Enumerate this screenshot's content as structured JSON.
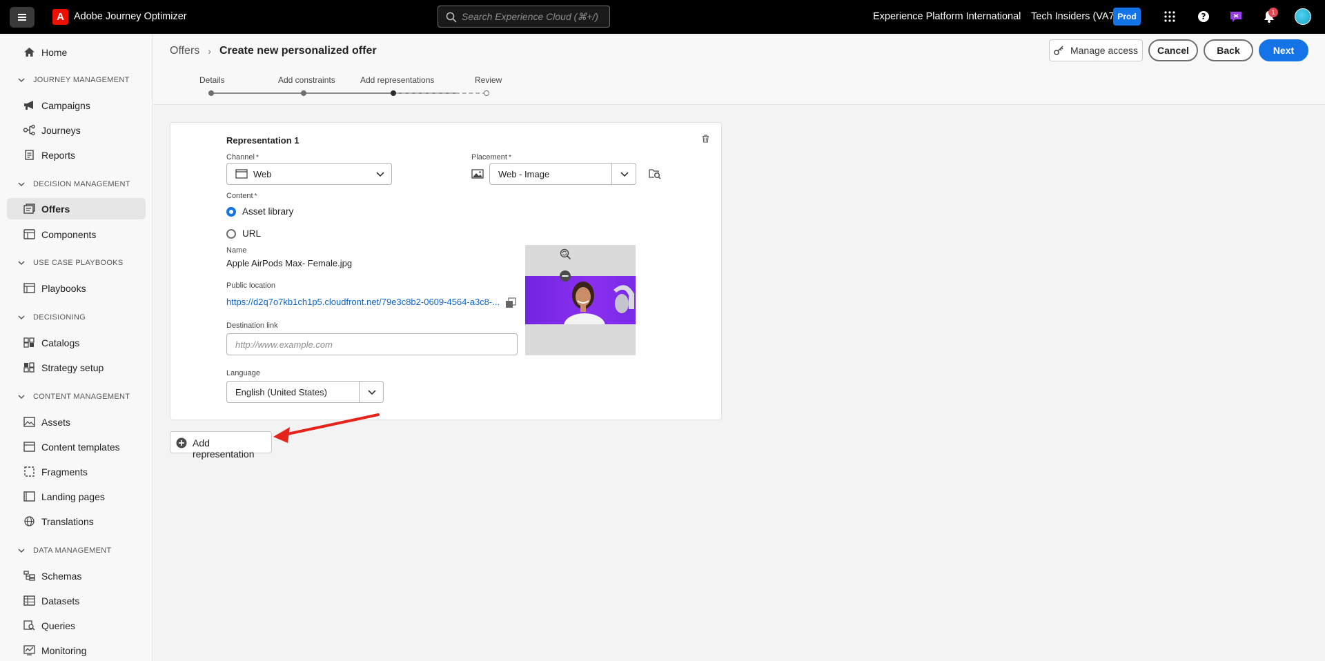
{
  "topbar": {
    "app_title": "Adobe Journey Optimizer",
    "search_placeholder": "Search Experience Cloud (⌘+/)",
    "org_name": "Experience Platform International",
    "sandbox_name": "Tech Insiders (VA7)",
    "env_badge": "Prod",
    "notification_count": "1"
  },
  "sidebar": {
    "home": "Home",
    "sections": [
      {
        "title": "JOURNEY MANAGEMENT",
        "items": [
          "Campaigns",
          "Journeys",
          "Reports"
        ]
      },
      {
        "title": "DECISION MANAGEMENT",
        "items": [
          "Offers",
          "Components"
        ]
      },
      {
        "title": "USE CASE PLAYBOOKS",
        "items": [
          "Playbooks"
        ]
      },
      {
        "title": "DECISIONING",
        "items": [
          "Catalogs",
          "Strategy setup"
        ]
      },
      {
        "title": "CONTENT MANAGEMENT",
        "items": [
          "Assets",
          "Content templates",
          "Fragments",
          "Landing pages",
          "Translations"
        ]
      },
      {
        "title": "DATA MANAGEMENT",
        "items": [
          "Schemas",
          "Datasets",
          "Queries",
          "Monitoring"
        ]
      }
    ],
    "active_item": "Offers"
  },
  "header": {
    "breadcrumb_parent": "Offers",
    "breadcrumb_current": "Create new personalized offer",
    "manage_access": "Manage access",
    "cancel": "Cancel",
    "back": "Back",
    "next": "Next"
  },
  "stepper": {
    "steps": [
      "Details",
      "Add constraints",
      "Add representations",
      "Review"
    ],
    "current_step": "Add representations"
  },
  "representation": {
    "title": "Representation 1",
    "channel_label": "Channel",
    "channel_value": "Web",
    "placement_label": "Placement",
    "placement_value": "Web - Image",
    "content_label": "Content",
    "content_options": [
      "Asset library",
      "URL"
    ],
    "content_selected": "Asset library",
    "name_label": "Name",
    "name_value": "Apple AirPods Max- Female.jpg",
    "public_location_label": "Public location",
    "public_location_value": "https://d2q7o7kb1ch1p5.cloudfront.net/79e3c8b2-0609-4564-a3c8-...",
    "destination_link_label": "Destination link",
    "destination_link_placeholder": "http://www.example.com",
    "language_label": "Language",
    "language_value": "English (United States)",
    "required_marker": "*"
  },
  "add_representation": "Add representation",
  "colors": {
    "accent": "#1473e6",
    "topbar": "#000000",
    "annotation_arrow": "#e5231b",
    "thumbnail_bg": "#7a29e8"
  }
}
